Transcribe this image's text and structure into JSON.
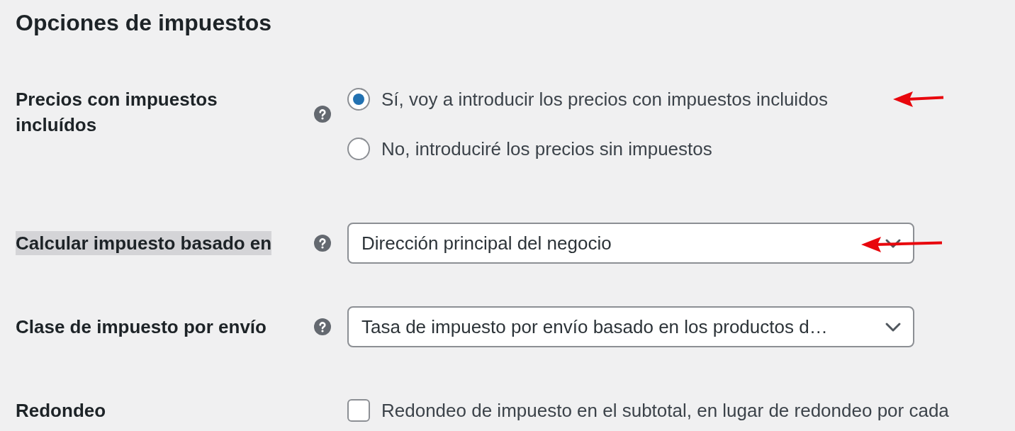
{
  "section": {
    "title": "Opciones de impuestos"
  },
  "settings": [
    {
      "kind": "radio",
      "label": "Precios con impuestos incluídos",
      "label_highlighted": false,
      "help": true,
      "options": [
        {
          "label": "Sí, voy a introducir los precios con impuestos incluidos",
          "selected": true,
          "arrow": true
        },
        {
          "label": "No, introduciré los precios sin impuestos",
          "selected": false,
          "arrow": false
        }
      ]
    },
    {
      "kind": "select",
      "label": "Calcular impuesto basado en",
      "label_highlighted": true,
      "help": true,
      "value": "Dirección principal del negocio",
      "arrow": true
    },
    {
      "kind": "select",
      "label": "Clase de impuesto por envío",
      "label_highlighted": false,
      "help": true,
      "value": "Tasa de impuesto por envío basado en los productos d…",
      "arrow": false
    },
    {
      "kind": "checkbox",
      "label": "Redondeo",
      "label_highlighted": false,
      "help": false,
      "checked": false,
      "text": "Redondeo de impuesto en el subtotal, en lugar de redondeo por cada"
    }
  ]
}
